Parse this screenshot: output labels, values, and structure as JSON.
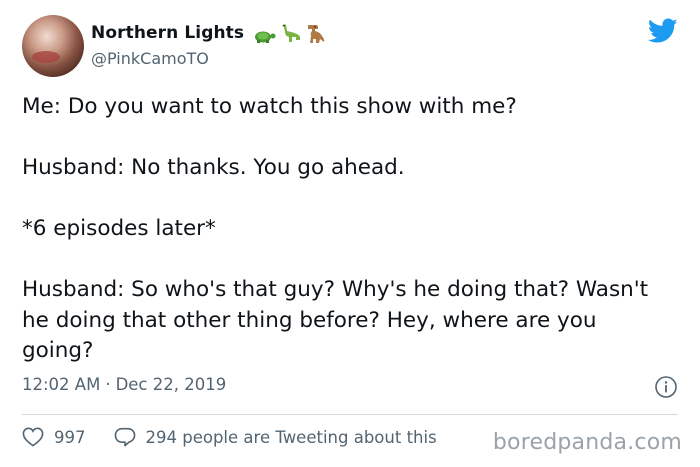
{
  "author": {
    "display_name": "Northern Lights",
    "handle": "@PinkCamoTO",
    "name_emojis": [
      "turtle-emoji",
      "sauropod-emoji",
      "t-rex-emoji"
    ]
  },
  "tweet": {
    "text": "Me: Do you want to watch this show with me?\n\nHusband: No thanks. You go ahead.\n\n*6 episodes later*\n\nHusband: So who's that guy? Why's he doing that? Wasn't he doing that other thing before? Hey, where are you going?",
    "time": "12:02 AM",
    "separator": "·",
    "date": "Dec 22, 2019"
  },
  "engagement": {
    "likes": "997",
    "comments_text": "294 people are Tweeting about this"
  },
  "watermark": "boredpanda.com",
  "colors": {
    "twitter_blue": "#1d9bf0",
    "muted_text": "#536471",
    "turtle_green": "#4b9b33",
    "dino_green": "#7bb342",
    "trex_brown": "#b07a47"
  },
  "icons": [
    "twitter-bird-icon",
    "info-icon",
    "heart-icon",
    "comment-icon"
  ]
}
